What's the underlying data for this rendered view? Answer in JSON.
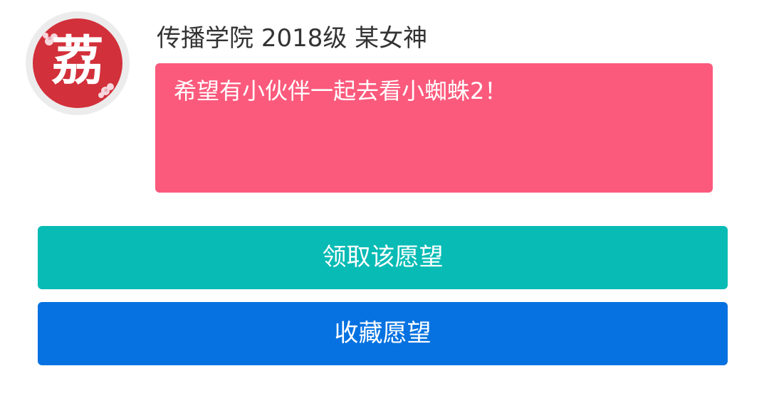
{
  "avatar": {
    "char": "荔",
    "bg_color": "#d2303a"
  },
  "user": {
    "college": "传播学院",
    "year": "2018级",
    "nickname": "某女神"
  },
  "wish": {
    "text": "希望有小伙伴一起去看小蜘蛛2！",
    "card_color": "#fb5a7c"
  },
  "actions": {
    "claim_label": "领取该愿望",
    "claim_color": "#08bbb5",
    "favorite_label": "收藏愿望",
    "favorite_color": "#0672e1"
  }
}
